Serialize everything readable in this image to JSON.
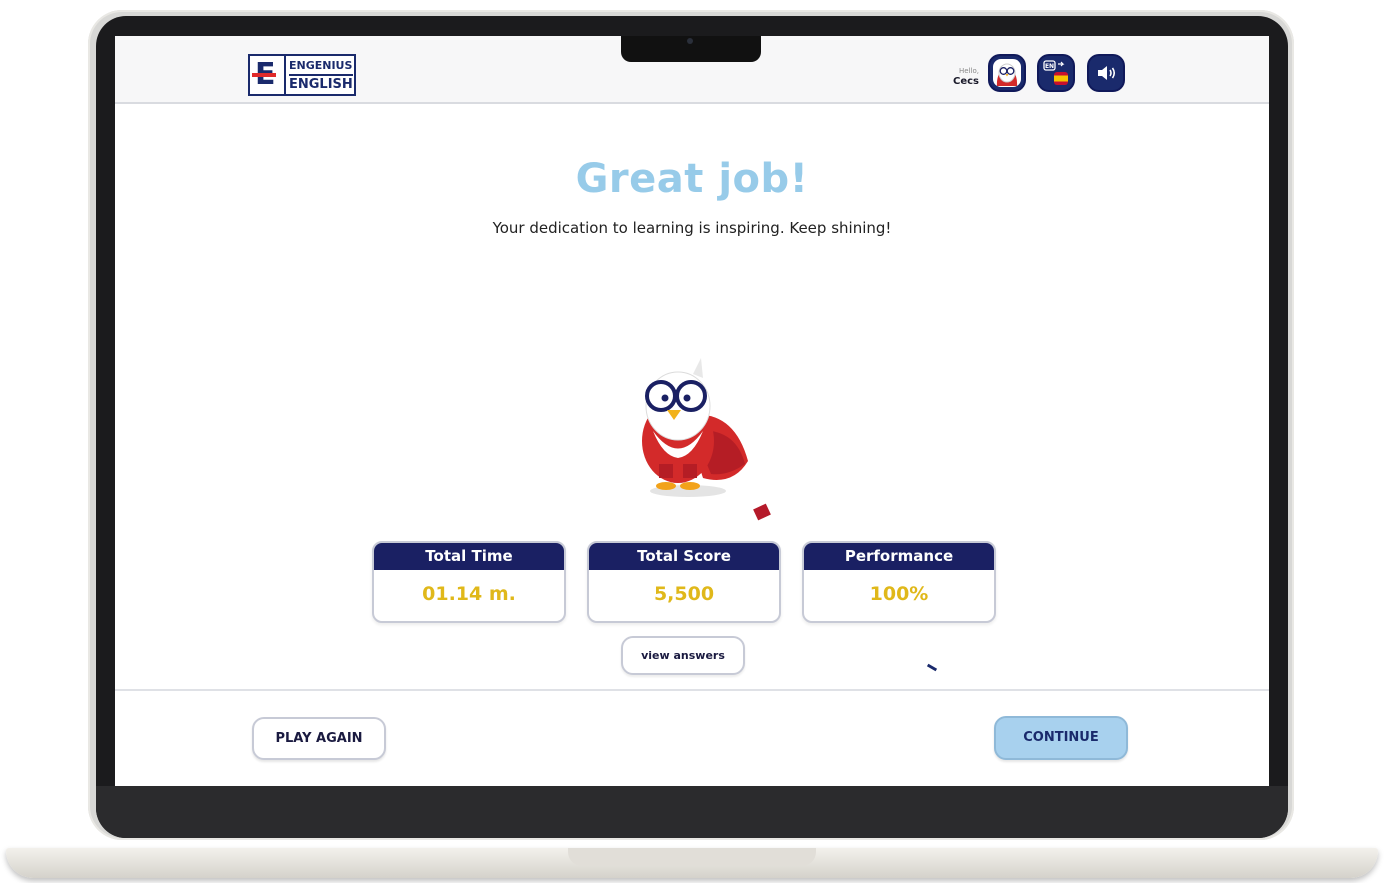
{
  "header": {
    "logo_line1": "ENGENIUS",
    "logo_line2": "ENGLISH",
    "greeting": "Hello,",
    "user_name": "Cecs",
    "lang_code": "EN"
  },
  "result": {
    "title": "Great job!",
    "message": "Your dedication to learning is inspiring. Keep shining!"
  },
  "stats": [
    {
      "label": "Total Time",
      "value": "01.14 m."
    },
    {
      "label": "Total Score",
      "value": "5,500"
    },
    {
      "label": "Performance",
      "value": "100%"
    }
  ],
  "buttons": {
    "view_answers": "view answers",
    "play_again": "PLAY AGAIN",
    "continue": "CONTINUE"
  },
  "colors": {
    "navy": "#1a2063",
    "headline_blue": "#97cbe9",
    "value_gold": "#e0b81a",
    "continue_bg": "#a8d1ee",
    "mascot_red": "#d32a2a"
  },
  "icons": {
    "avatar": "owl-avatar-icon",
    "language": "language-switch-icon",
    "sound": "speaker-icon"
  }
}
